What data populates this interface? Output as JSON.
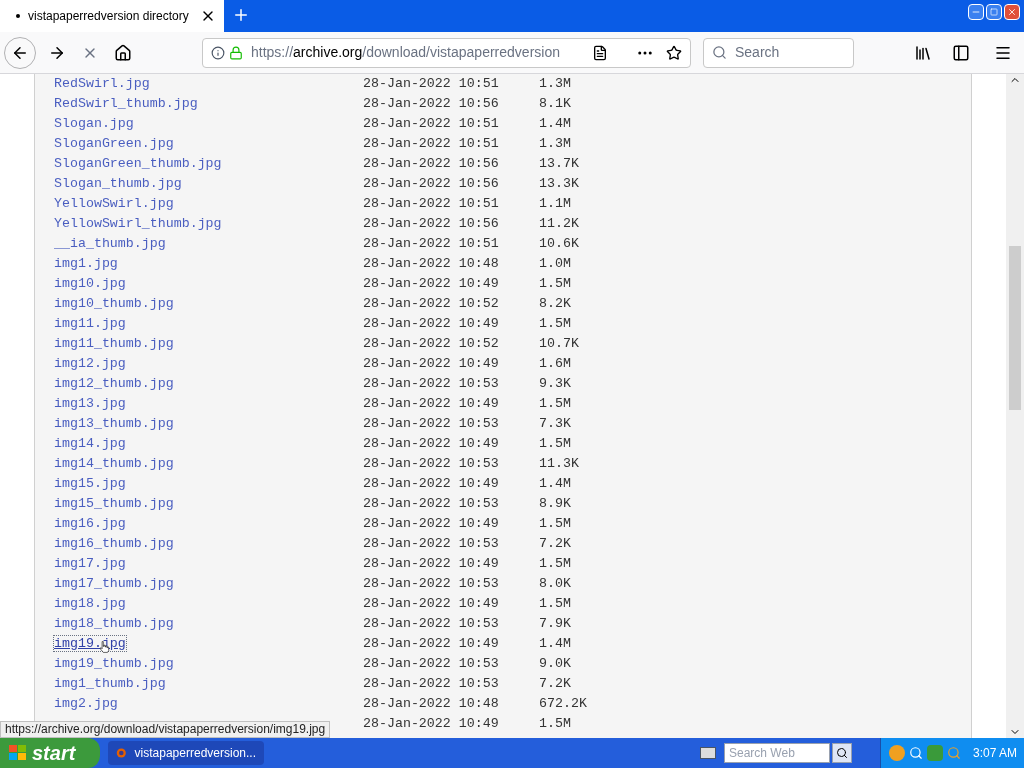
{
  "tab": {
    "title": "vistapaperredversion directory",
    "selected": true
  },
  "address": {
    "prefix": "https://",
    "domain": "archive.org",
    "path": "/download/vistapaperredversion"
  },
  "search": {
    "placeholder": "Search"
  },
  "files": [
    {
      "name": "RedSwirl.jpg",
      "date": "28-Jan-2022 10:51",
      "size": "1.3M",
      "hovered": false
    },
    {
      "name": "RedSwirl_thumb.jpg",
      "date": "28-Jan-2022 10:56",
      "size": "8.1K",
      "hovered": false
    },
    {
      "name": "Slogan.jpg",
      "date": "28-Jan-2022 10:51",
      "size": "1.4M",
      "hovered": false
    },
    {
      "name": "SloganGreen.jpg",
      "date": "28-Jan-2022 10:51",
      "size": "1.3M",
      "hovered": false
    },
    {
      "name": "SloganGreen_thumb.jpg",
      "date": "28-Jan-2022 10:56",
      "size": "13.7K",
      "hovered": false
    },
    {
      "name": "Slogan_thumb.jpg",
      "date": "28-Jan-2022 10:56",
      "size": "13.3K",
      "hovered": false
    },
    {
      "name": "YellowSwirl.jpg",
      "date": "28-Jan-2022 10:51",
      "size": "1.1M",
      "hovered": false
    },
    {
      "name": "YellowSwirl_thumb.jpg",
      "date": "28-Jan-2022 10:56",
      "size": "11.2K",
      "hovered": false
    },
    {
      "name": "__ia_thumb.jpg",
      "date": "28-Jan-2022 10:51",
      "size": "10.6K",
      "hovered": false
    },
    {
      "name": "img1.jpg",
      "date": "28-Jan-2022 10:48",
      "size": "1.0M",
      "hovered": false
    },
    {
      "name": "img10.jpg",
      "date": "28-Jan-2022 10:49",
      "size": "1.5M",
      "hovered": false
    },
    {
      "name": "img10_thumb.jpg",
      "date": "28-Jan-2022 10:52",
      "size": "8.2K",
      "hovered": false
    },
    {
      "name": "img11.jpg",
      "date": "28-Jan-2022 10:49",
      "size": "1.5M",
      "hovered": false
    },
    {
      "name": "img11_thumb.jpg",
      "date": "28-Jan-2022 10:52",
      "size": "10.7K",
      "hovered": false
    },
    {
      "name": "img12.jpg",
      "date": "28-Jan-2022 10:49",
      "size": "1.6M",
      "hovered": false
    },
    {
      "name": "img12_thumb.jpg",
      "date": "28-Jan-2022 10:53",
      "size": "9.3K",
      "hovered": false
    },
    {
      "name": "img13.jpg",
      "date": "28-Jan-2022 10:49",
      "size": "1.5M",
      "hovered": false
    },
    {
      "name": "img13_thumb.jpg",
      "date": "28-Jan-2022 10:53",
      "size": "7.3K",
      "hovered": false
    },
    {
      "name": "img14.jpg",
      "date": "28-Jan-2022 10:49",
      "size": "1.5M",
      "hovered": false
    },
    {
      "name": "img14_thumb.jpg",
      "date": "28-Jan-2022 10:53",
      "size": "11.3K",
      "hovered": false
    },
    {
      "name": "img15.jpg",
      "date": "28-Jan-2022 10:49",
      "size": "1.4M",
      "hovered": false
    },
    {
      "name": "img15_thumb.jpg",
      "date": "28-Jan-2022 10:53",
      "size": "8.9K",
      "hovered": false
    },
    {
      "name": "img16.jpg",
      "date": "28-Jan-2022 10:49",
      "size": "1.5M",
      "hovered": false
    },
    {
      "name": "img16_thumb.jpg",
      "date": "28-Jan-2022 10:53",
      "size": "7.2K",
      "hovered": false
    },
    {
      "name": "img17.jpg",
      "date": "28-Jan-2022 10:49",
      "size": "1.5M",
      "hovered": false
    },
    {
      "name": "img17_thumb.jpg",
      "date": "28-Jan-2022 10:53",
      "size": "8.0K",
      "hovered": false
    },
    {
      "name": "img18.jpg",
      "date": "28-Jan-2022 10:49",
      "size": "1.5M",
      "hovered": false
    },
    {
      "name": "img18_thumb.jpg",
      "date": "28-Jan-2022 10:53",
      "size": "7.9K",
      "hovered": false
    },
    {
      "name": "img19.jpg",
      "date": "28-Jan-2022 10:49",
      "size": "1.4M",
      "hovered": true
    },
    {
      "name": "img19_thumb.jpg",
      "date": "28-Jan-2022 10:53",
      "size": "9.0K",
      "hovered": false
    },
    {
      "name": "img1_thumb.jpg",
      "date": "28-Jan-2022 10:53",
      "size": "7.2K",
      "hovered": false
    },
    {
      "name": "img2.jpg",
      "date": "28-Jan-2022 10:48",
      "size": "672.2K",
      "hovered": false
    },
    {
      "date": "28-Jan-2022 10:49",
      "size": "1.5M"
    }
  ],
  "status_url": "https://archive.org/download/vistapaperredversion/img19.jpg",
  "taskbar": {
    "start": "start",
    "task": "vistapaperredversion...",
    "search_placeholder": "Search Web",
    "clock": "3:07 AM"
  }
}
